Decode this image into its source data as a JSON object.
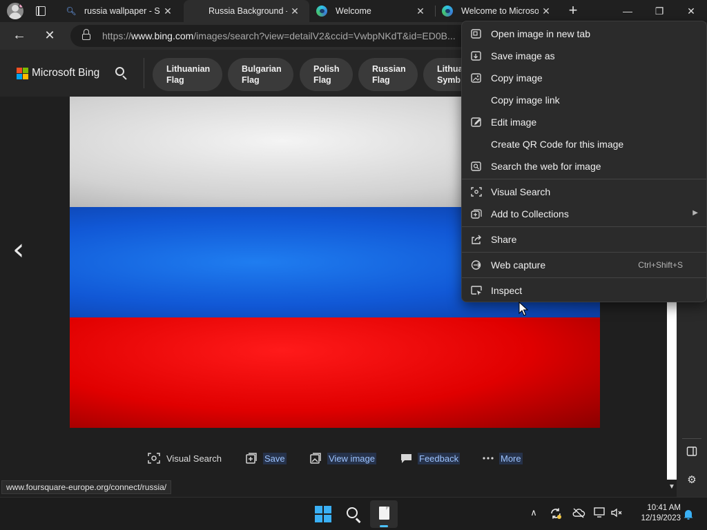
{
  "browser": {
    "tabs": [
      {
        "title": "russia wallpaper - Search",
        "favicon": "bing-search-icon",
        "active": false
      },
      {
        "title": "Russia Background - Search",
        "favicon": "bing-search-icon",
        "active": true
      },
      {
        "title": "Welcome",
        "favicon": "edge-icon",
        "active": false
      },
      {
        "title": "Welcome to Microsoft Edge",
        "favicon": "edge-icon",
        "active": false
      }
    ],
    "tab_close_glyph": "✕",
    "new_tab_glyph": "+",
    "window_controls": {
      "minimize": "—",
      "maximize": "❐",
      "close": "✕"
    },
    "url_prefix": "https://",
    "url_domain": "www.bing.com",
    "url_path": "/images/search?view=detailV2&ccid=VwbpNKdT&id=ED0B..."
  },
  "bing": {
    "brand": "Microsoft Bing",
    "chips": [
      {
        "line1": "Lithuanian",
        "line2": "Flag"
      },
      {
        "line1": "Bulgarian",
        "line2": "Flag"
      },
      {
        "line1": "Polish",
        "line2": "Flag"
      },
      {
        "line1": "Russian",
        "line2": "Flag"
      },
      {
        "line1": "Lithua",
        "line2": "Symb"
      }
    ],
    "prev_glyph": "‹"
  },
  "image_actions": {
    "visual_search": "Visual Search",
    "save": "Save",
    "view_image": "View image",
    "feedback": "Feedback",
    "more": "More"
  },
  "status_url": "www.foursquare-europe.org/connect/russia/",
  "context_menu": {
    "open_new_tab": "Open image in new tab",
    "save_as": "Save image as",
    "copy_image": "Copy image",
    "copy_link": "Copy image link",
    "edit_image": "Edit image",
    "qr_code": "Create QR Code for this image",
    "search_web": "Search the web for image",
    "visual_search": "Visual Search",
    "add_collections": "Add to Collections",
    "share": "Share",
    "web_capture": "Web capture",
    "web_capture_shortcut": "Ctrl+Shift+S",
    "inspect": "Inspect"
  },
  "taskbar": {
    "time": "10:41 AM",
    "date": "12/19/2023"
  },
  "colors": {
    "flag_white": "#e6e6e6",
    "flag_blue": "#1166dd",
    "flag_red": "#e40000",
    "link_highlight": "#9cc3ff",
    "windows_blue": "#3ab0f5"
  }
}
